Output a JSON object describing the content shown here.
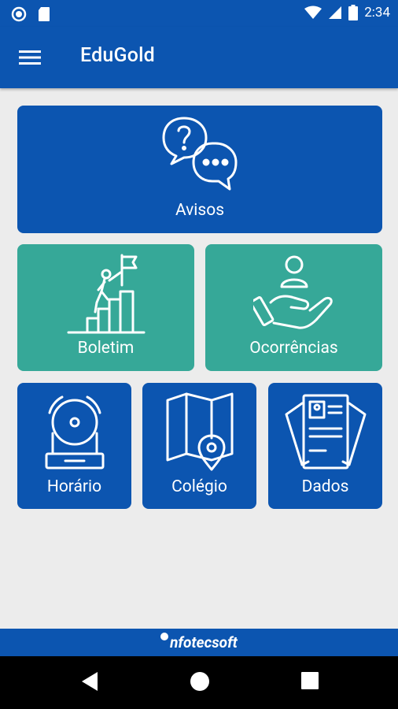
{
  "status_bar": {
    "time": "2:34"
  },
  "app_bar": {
    "title": "EduGold"
  },
  "tiles": {
    "avisos": "Avisos",
    "boletim": "Boletim",
    "ocorrencias": "Ocorrências",
    "horario": "Horário",
    "colegio": "Colégio",
    "dados": "Dados"
  },
  "footer": {
    "brand": "nfotecsoft"
  },
  "colors": {
    "primary": "#0c55b0",
    "teal": "#36a898",
    "background": "#ececec"
  },
  "icons": {
    "avisos": "question-chat-icon",
    "boletim": "climber-flag-icon",
    "ocorrencias": "hand-person-icon",
    "horario": "alarm-bell-icon",
    "colegio": "map-pin-icon",
    "dados": "id-documents-icon"
  }
}
